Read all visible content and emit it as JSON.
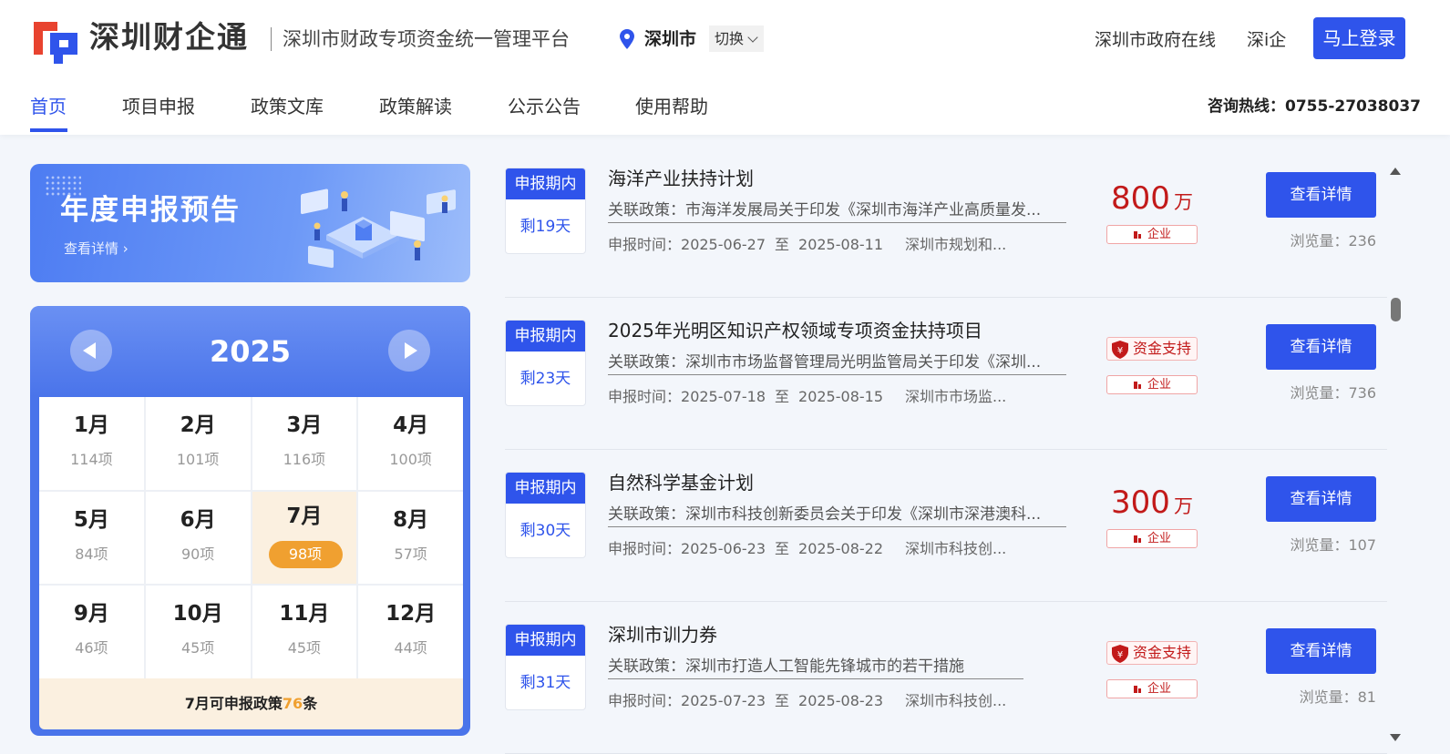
{
  "header": {
    "brand_name": "深圳财企通",
    "brand_subtitle": "深圳市财政专项资金统一管理平台",
    "city": "深圳市",
    "switch_label": "切换",
    "links": [
      "深圳市政府在线",
      "深i企"
    ],
    "login_label": "马上登录",
    "hotline": "咨询热线：0755-27038037",
    "brand_color": "#2f54eb",
    "logo_colors": [
      "#e8432f",
      "#2f54eb"
    ]
  },
  "nav": {
    "items": [
      "首页",
      "项目申报",
      "政策文库",
      "政策解读",
      "公示公告",
      "使用帮助"
    ],
    "active_index": 0
  },
  "banner": {
    "title": "年度申报预告",
    "link": "查看详情 ›"
  },
  "calendar": {
    "year": "2025",
    "months": [
      {
        "month": "1月",
        "count": "114项"
      },
      {
        "month": "2月",
        "count": "101项"
      },
      {
        "month": "3月",
        "count": "116项"
      },
      {
        "month": "4月",
        "count": "100项"
      },
      {
        "month": "5月",
        "count": "84项"
      },
      {
        "month": "6月",
        "count": "90项"
      },
      {
        "month": "7月",
        "count": "98项"
      },
      {
        "month": "8月",
        "count": "57项"
      },
      {
        "month": "9月",
        "count": "46项"
      },
      {
        "month": "10月",
        "count": "45项"
      },
      {
        "month": "11月",
        "count": "45项"
      },
      {
        "month": "12月",
        "count": "44项"
      }
    ],
    "active_month_index": 6,
    "footer_prefix": "7月可申报政策",
    "footer_count": "76",
    "footer_suffix": "条",
    "highlight_color": "#f0a030"
  },
  "list": {
    "items": [
      {
        "status": "申报期内",
        "days_left": "剩19天",
        "title": "海洋产业扶持计划",
        "policy": "关联政策：市海洋发展局关于印发《深圳市海洋产业高质量发...",
        "time_label": "申报时间：",
        "start": "2025-06-27",
        "to": "至",
        "end": "2025-08-11",
        "dept": "深圳市规划和...",
        "amount": "800",
        "unit": "万",
        "funding_tag": "",
        "ent_tag": "企业",
        "detail_label": "查看详情",
        "views": "浏览量：236"
      },
      {
        "status": "申报期内",
        "days_left": "剩23天",
        "title": "2025年光明区知识产权领域专项资金扶持项目",
        "policy": "关联政策：深圳市市场监督管理局光明监管局关于印发《深圳...",
        "time_label": "申报时间：",
        "start": "2025-07-18",
        "to": "至",
        "end": "2025-08-15",
        "dept": "深圳市市场监...",
        "amount": "",
        "unit": "",
        "funding_tag": "资金支持",
        "ent_tag": "企业",
        "detail_label": "查看详情",
        "views": "浏览量：736"
      },
      {
        "status": "申报期内",
        "days_left": "剩30天",
        "title": "自然科学基金计划",
        "policy": "关联政策：深圳市科技创新委员会关于印发《深圳市深港澳科...",
        "time_label": "申报时间：",
        "start": "2025-06-23",
        "to": "至",
        "end": "2025-08-22",
        "dept": "深圳市科技创...",
        "amount": "300",
        "unit": "万",
        "funding_tag": "",
        "ent_tag": "企业",
        "detail_label": "查看详情",
        "views": "浏览量：107"
      },
      {
        "status": "申报期内",
        "days_left": "剩31天",
        "title": "深圳市训力券",
        "policy": "关联政策：深圳市打造人工智能先锋城市的若干措施",
        "time_label": "申报时间：",
        "start": "2025-07-23",
        "to": "至",
        "end": "2025-08-23",
        "dept": "深圳市科技创...",
        "amount": "",
        "unit": "",
        "funding_tag": "资金支持",
        "ent_tag": "企业",
        "detail_label": "查看详情",
        "views": "浏览量：81"
      }
    ],
    "amount_color": "#c21a1a"
  }
}
